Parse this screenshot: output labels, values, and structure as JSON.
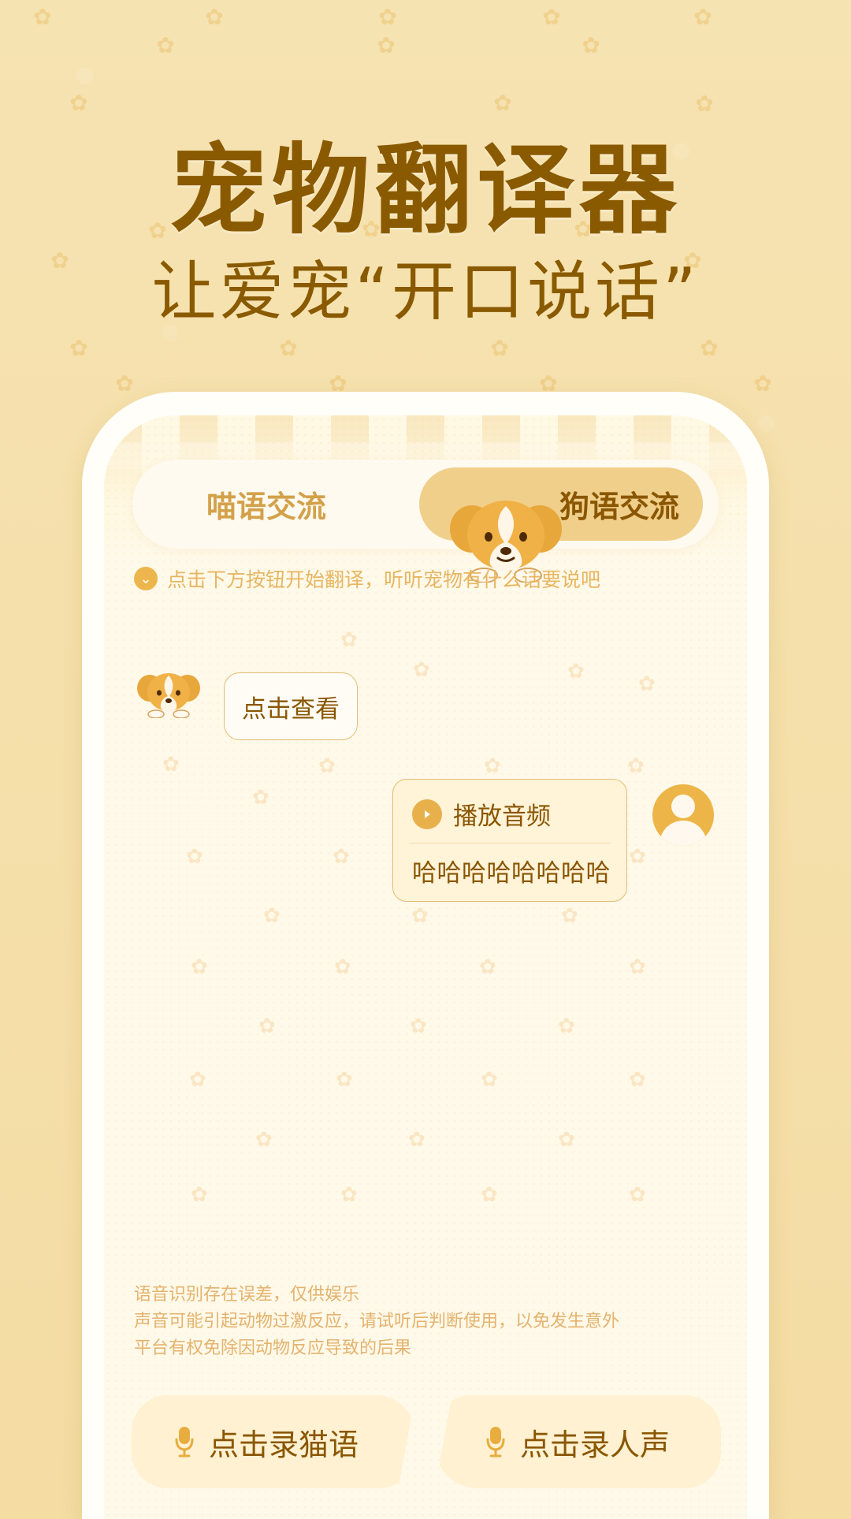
{
  "page": {
    "headline": "宠物翻译器",
    "subheadline": "让爱宠“开口说话”"
  },
  "tabs": [
    {
      "label": "喵语交流",
      "active": false
    },
    {
      "label": "狗语交流",
      "active": true
    }
  ],
  "hint": {
    "icon": "double-chevron-down-icon",
    "text": "点击下方按钮开始翻译，听听宠物有什么话要说吧"
  },
  "chat": {
    "left_bubble": "点击查看",
    "right_bubble": {
      "play_label": "播放音频",
      "text": "哈哈哈哈哈哈哈哈"
    }
  },
  "disclaimer": {
    "line1": "语音识别存在误差，仅供娱乐",
    "line2": "声音可能引起动物过激反应，请试听后判断使用，以免发生意外",
    "line3": "平台有权免除因动物反应导致的后果"
  },
  "actions": {
    "record_cat": "点击录猫语",
    "record_human": "点击录人声"
  },
  "colors": {
    "background": "#f4dca3",
    "brand_brown": "#8a5a00",
    "accent_gold": "#e8b04b",
    "card_cream": "#fff7e0"
  }
}
